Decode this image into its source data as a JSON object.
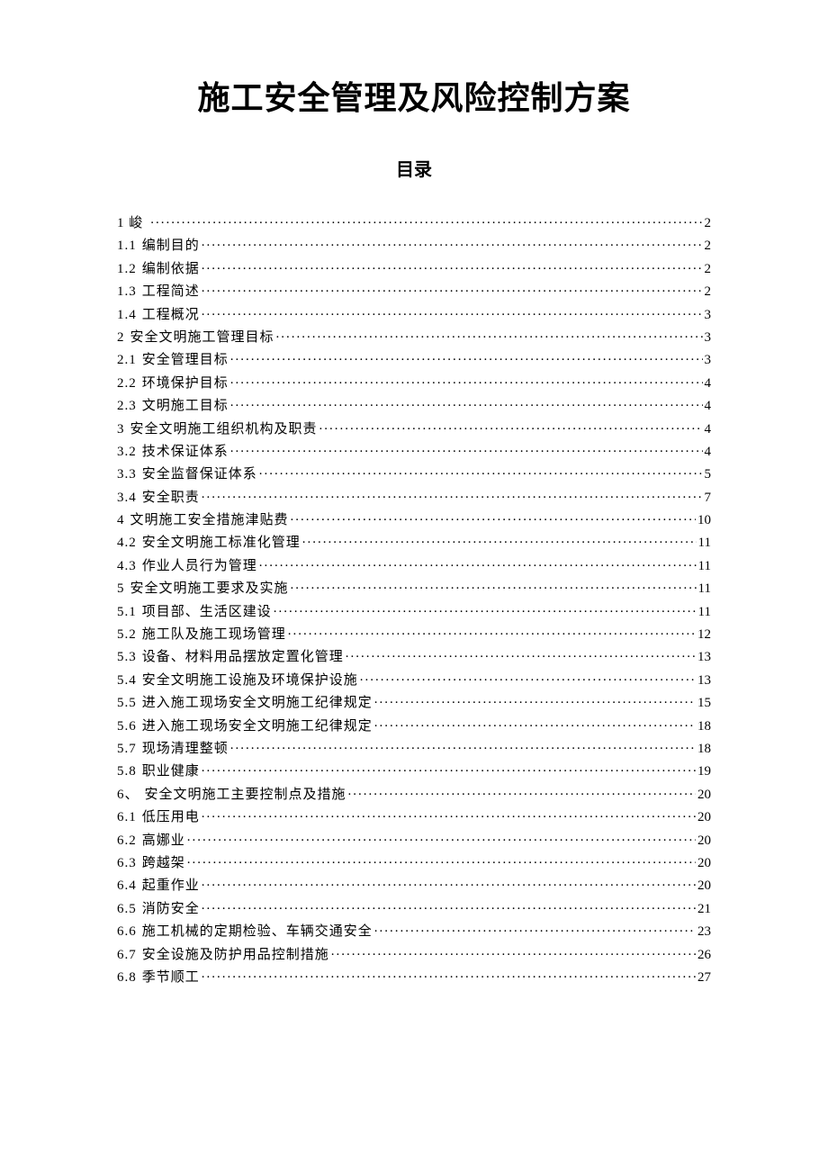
{
  "title": "施工安全管理及风险控制方案",
  "subtitle": "目录",
  "toc": [
    {
      "num": "1 峻",
      "label": "",
      "page": "2"
    },
    {
      "num": "1.1",
      "label": "编制目的",
      "page": "2"
    },
    {
      "num": "1.2",
      "label": "编制依据",
      "page": "2"
    },
    {
      "num": "1.3",
      "label": "工程简述",
      "page": "2"
    },
    {
      "num": "1.4",
      "label": "工程概况",
      "page": "3"
    },
    {
      "num": "2",
      "label": "安全文明施工管理目标",
      "page": "3"
    },
    {
      "num": "2.1",
      "label": "安全管理目标",
      "page": "3"
    },
    {
      "num": "2.2",
      "label": "环境保护目标",
      "page": "4"
    },
    {
      "num": "2.3",
      "label": "文明施工目标",
      "page": "4"
    },
    {
      "num": "3",
      "label": "安全文明施工组织机构及职责",
      "page": "4"
    },
    {
      "num": "3.2",
      "label": "技术保证体系",
      "page": "4"
    },
    {
      "num": "3.3",
      "label": "安全监督保证体系",
      "page": "5"
    },
    {
      "num": "3.4",
      "label": "安全职责",
      "page": "7"
    },
    {
      "num": "4",
      "label": "文明施工安全措施津贴费",
      "page": "10"
    },
    {
      "num": "4.2",
      "label": "安全文明施工标准化管理",
      "page": "11"
    },
    {
      "num": "4.3",
      "label": "作业人员行为管理",
      "page": "11"
    },
    {
      "num": "5",
      "label": "安全文明施工要求及实施",
      "page": "11"
    },
    {
      "num": "5.1",
      "label": "项目部、生活区建设",
      "page": "11"
    },
    {
      "num": "5.2",
      "label": "施工队及施工现场管理",
      "page": "12"
    },
    {
      "num": "5.3",
      "label": "设备、材料用品摆放定置化管理",
      "page": "13"
    },
    {
      "num": "5.4",
      "label": "安全文明施工设施及环境保护设施",
      "page": "13"
    },
    {
      "num": "5.5",
      "label": "进入施工现场安全文明施工纪律规定",
      "page": "15"
    },
    {
      "num": "5.6",
      "label": "进入施工现场安全文明施工纪律规定",
      "page": "18"
    },
    {
      "num": "5.7",
      "label": "现场清理整顿",
      "page": "18"
    },
    {
      "num": "5.8",
      "label": "职业健康",
      "page": "19"
    },
    {
      "num": "6、",
      "label": "安全文明施工主要控制点及措施",
      "page": "20"
    },
    {
      "num": "6.1",
      "label": "低压用电",
      "page": "20"
    },
    {
      "num": "6.2",
      "label": "高娜业",
      "page": "20"
    },
    {
      "num": "6.3",
      "label": "跨越架",
      "page": "20"
    },
    {
      "num": "6.4",
      "label": "起重作业",
      "page": "20"
    },
    {
      "num": "6.5",
      "label": "消防安全",
      "page": "21"
    },
    {
      "num": "6.6",
      "label": "施工机械的定期检验、车辆交通安全",
      "page": "23"
    },
    {
      "num": "6.7",
      "label": "安全设施及防护用品控制措施",
      "page": "26"
    },
    {
      "num": "6.8",
      "label": "季节顺工",
      "page": "27"
    }
  ]
}
